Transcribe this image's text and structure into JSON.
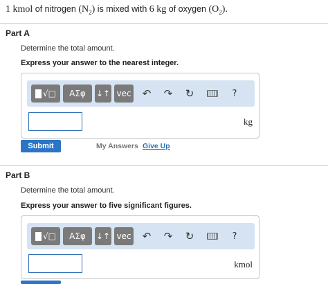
{
  "problem": {
    "q1": "1",
    "u1": "kmol",
    "t1": "of nitrogen",
    "s1": "N",
    "s1sub": "2",
    "t2": "is mixed with",
    "q2": "6",
    "u2": "kg",
    "t3": "of oxygen",
    "s2": "O",
    "s2sub": "2",
    "end": "."
  },
  "parts": [
    {
      "label": "Part A",
      "question": "Determine the total amount.",
      "instruction": "Express your answer to the nearest integer.",
      "unit": "kg",
      "input_value": ""
    },
    {
      "label": "Part B",
      "question": "Determine the total amount.",
      "instruction": "Express your answer to five significant figures.",
      "unit": "kmol",
      "input_value": ""
    }
  ],
  "toolbar": {
    "templates_glyph": "√□",
    "symbols_label": "ΑΣφ",
    "sort_glyph": "↓↑",
    "vec_label": "vec",
    "undo_glyph": "↶",
    "redo_glyph": "↷",
    "reset_glyph": "↻",
    "help_label": "?"
  },
  "actions": {
    "submit": "Submit",
    "my_answers": "My Answers",
    "give_up": "Give Up"
  }
}
